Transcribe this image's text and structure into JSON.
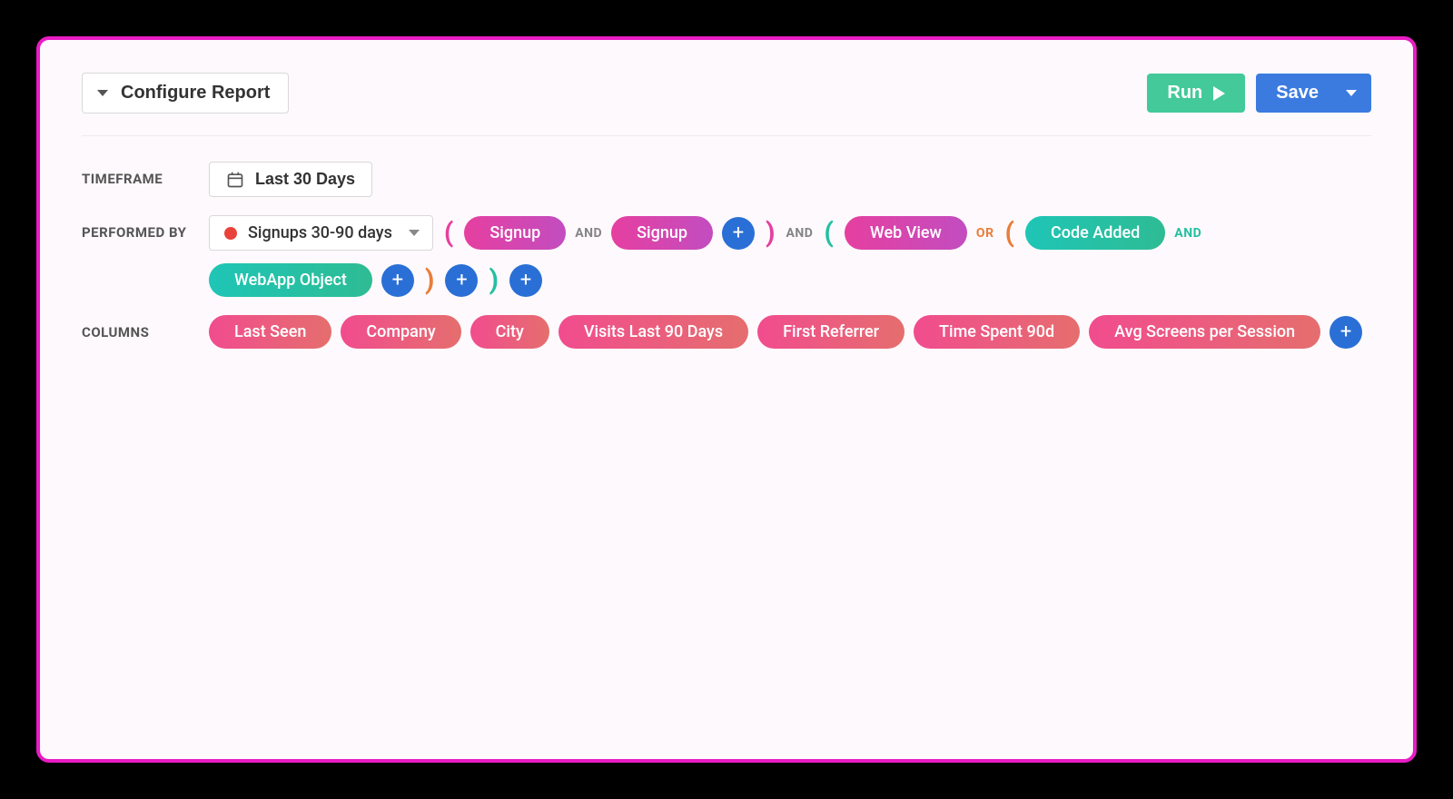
{
  "header": {
    "configure_label": "Configure Report",
    "run_label": "Run",
    "save_label": "Save"
  },
  "timeframe": {
    "label": "TIMEFRAME",
    "value": "Last 30 Days"
  },
  "performed_by": {
    "label": "PERFORMED BY",
    "segment": "Signups 30-90 days",
    "group1": {
      "event1": "Signup",
      "op1": "AND",
      "event2": "Signup"
    },
    "op_between_1_2": "AND",
    "group2": {
      "event1": "Web View",
      "op1": "OR",
      "group2a": {
        "event1": "Code Added",
        "op1": "AND",
        "event2": "WebApp Object"
      }
    }
  },
  "columns": {
    "label": "COLUMNS",
    "items": [
      "Last Seen",
      "Company",
      "City",
      "Visits Last 90 Days",
      "First Referrer",
      "Time Spent 90d",
      "Avg Screens per Session"
    ]
  }
}
